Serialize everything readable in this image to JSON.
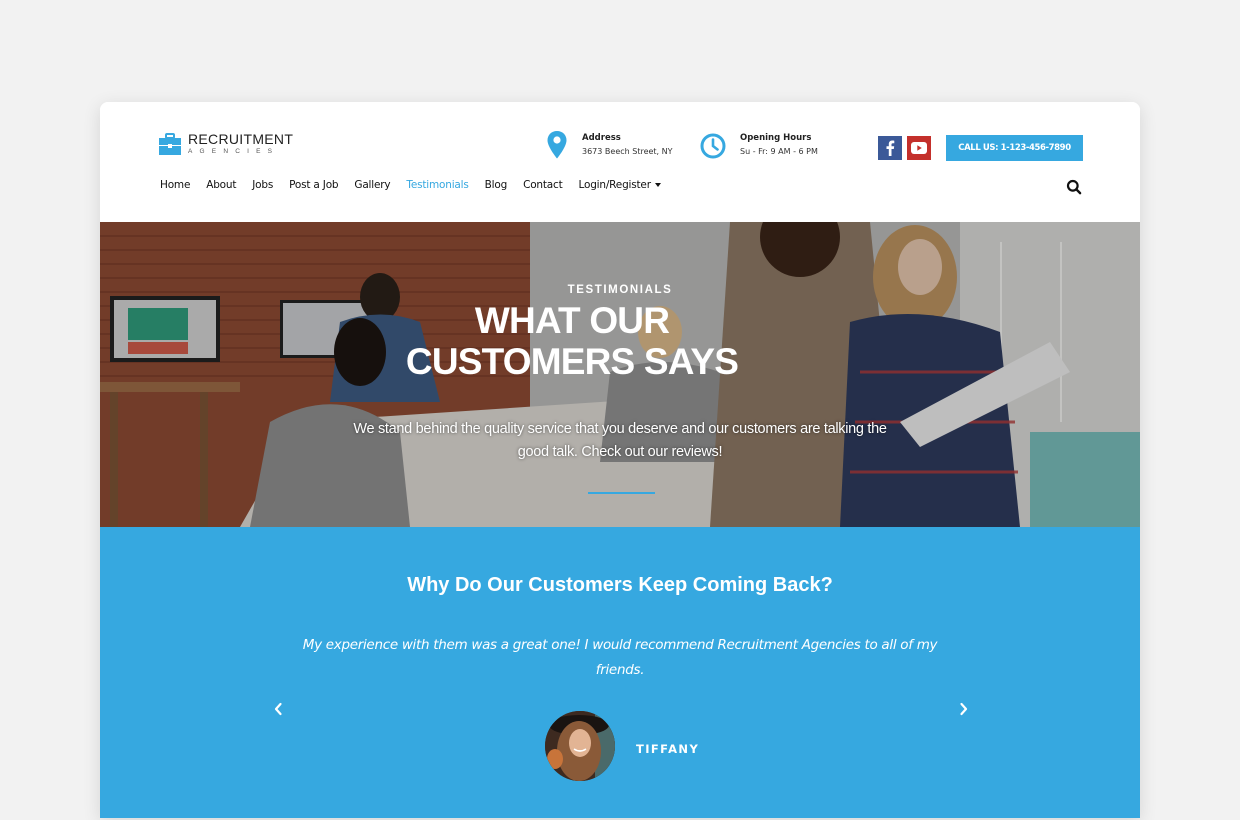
{
  "brand": {
    "name": "RECRUITMENT",
    "tagline": "AGENCIES",
    "accent_color": "#36a8e0"
  },
  "header": {
    "address": {
      "icon": "map-pin-icon",
      "label": "Address",
      "value": "3673 Beech Street, NY"
    },
    "hours": {
      "icon": "clock-icon",
      "label": "Opening Hours",
      "value": "Su - Fr: 9 AM - 6 PM"
    },
    "social": [
      {
        "name": "facebook",
        "icon": "facebook-icon",
        "color": "#3b5998"
      },
      {
        "name": "youtube",
        "icon": "youtube-icon",
        "color": "#c4302b"
      }
    ],
    "call_button": "CALL US: 1-123-456-7890"
  },
  "nav": {
    "items": [
      {
        "label": "Home",
        "active": false
      },
      {
        "label": "About",
        "active": false
      },
      {
        "label": "Jobs",
        "active": false
      },
      {
        "label": "Post a Job",
        "active": false
      },
      {
        "label": "Gallery",
        "active": false
      },
      {
        "label": "Testimonials",
        "active": true
      },
      {
        "label": "Blog",
        "active": false
      },
      {
        "label": "Contact",
        "active": false
      },
      {
        "label": "Login/Register",
        "active": false,
        "dropdown": true
      }
    ],
    "search_icon": "search-icon"
  },
  "hero": {
    "eyebrow": "TESTIMONIALS",
    "title": "WHAT OUR CUSTOMERS SAYS",
    "text": "We stand behind the quality service that you deserve and our customers are talking the good talk. Check out our reviews!"
  },
  "testimonials": {
    "heading": "Why Do Our Customers Keep Coming Back?",
    "quote": "My experience with them was a great one! I would recommend Recruitment Agencies to all of my friends.",
    "author": "TIFFANY",
    "prev_icon": "chevron-left-icon",
    "next_icon": "chevron-right-icon"
  }
}
